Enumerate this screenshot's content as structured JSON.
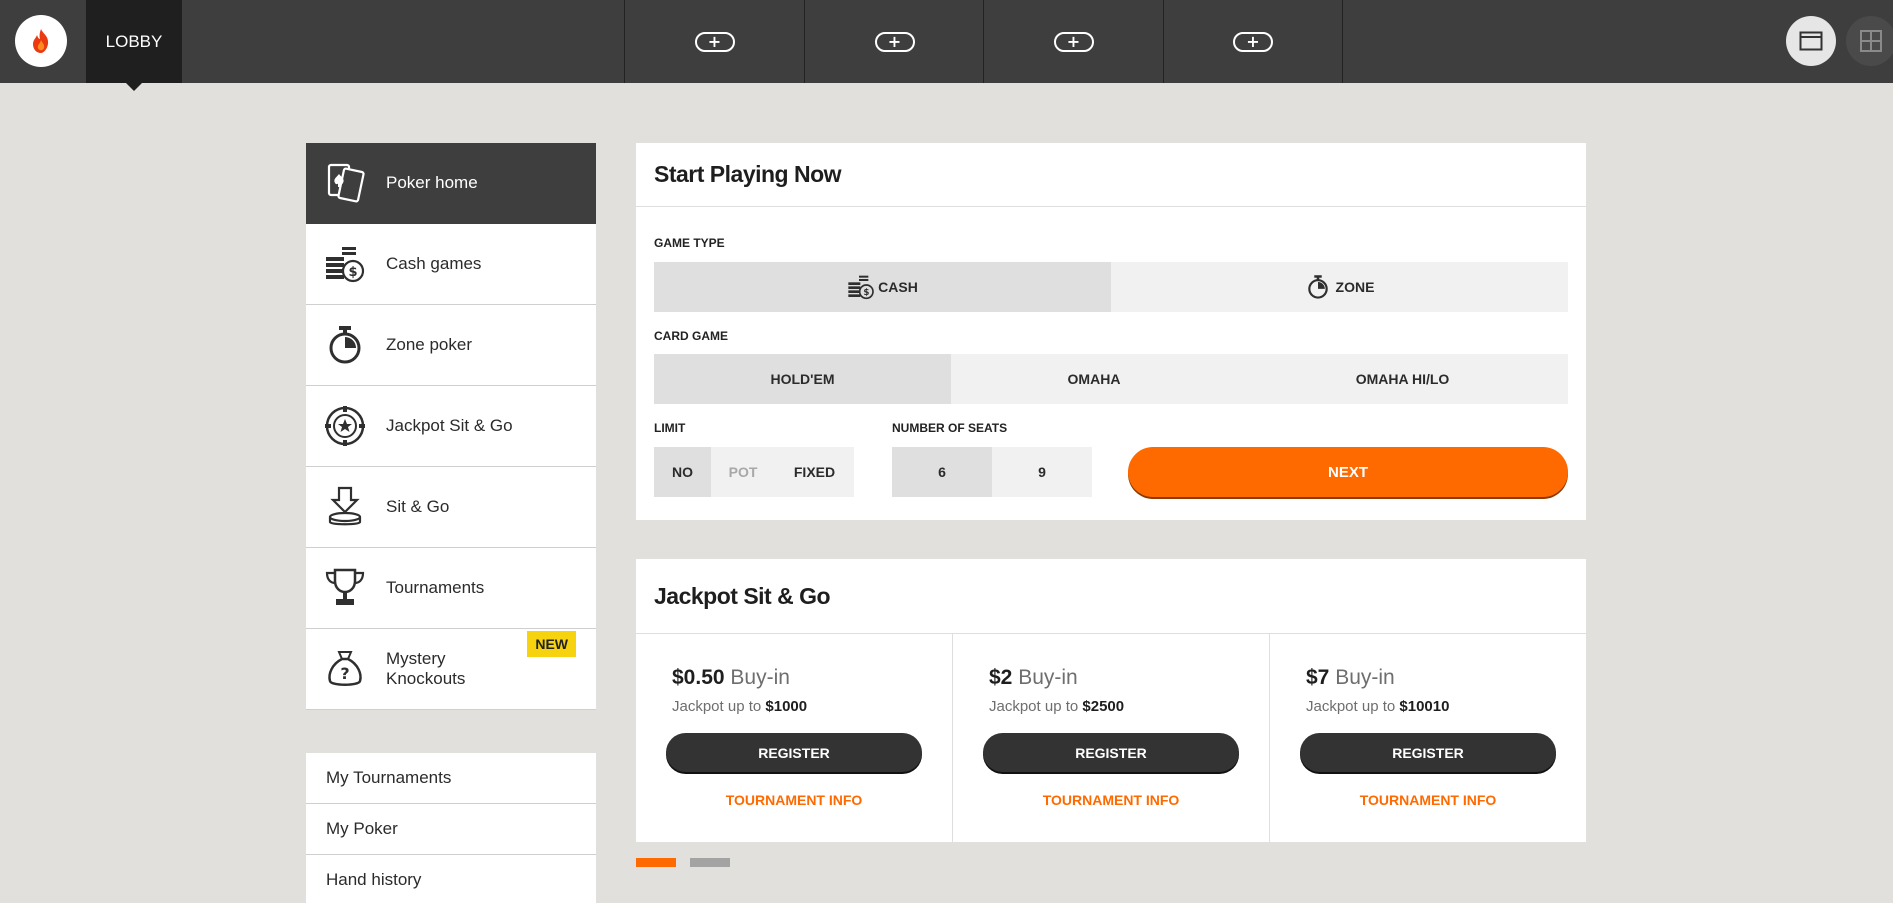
{
  "topbar": {
    "lobby_label": "LOBBY",
    "table_slots": [
      "+",
      "+",
      "+",
      "+"
    ]
  },
  "sidebar": {
    "items": [
      {
        "label": "Poker home",
        "icon": "cards-icon"
      },
      {
        "label": "Cash games",
        "icon": "coins-icon"
      },
      {
        "label": "Zone poker",
        "icon": "stopwatch-icon"
      },
      {
        "label": "Jackpot Sit & Go",
        "icon": "chip-star-icon"
      },
      {
        "label": "Sit & Go",
        "icon": "download-chips-icon"
      },
      {
        "label": "Tournaments",
        "icon": "trophy-icon"
      },
      {
        "label": "Mystery Knockouts",
        "icon": "mystery-bag-icon",
        "badge": "NEW"
      }
    ],
    "secondary": [
      "My Tournaments",
      "My Poker",
      "Hand history"
    ]
  },
  "start": {
    "title": "Start Playing Now",
    "game_type_label": "GAME TYPE",
    "game_types": [
      "CASH",
      "ZONE"
    ],
    "card_game_label": "CARD GAME",
    "card_games": [
      "HOLD'EM",
      "OMAHA",
      "OMAHA HI/LO"
    ],
    "limit_label": "LIMIT",
    "limits": [
      "NO",
      "POT",
      "FIXED"
    ],
    "seats_label": "NUMBER OF SEATS",
    "seats": [
      "6",
      "9"
    ],
    "next_label": "NEXT"
  },
  "jackpot": {
    "title": "Jackpot Sit & Go",
    "cards": [
      {
        "price": "$0.50",
        "buyin": "Buy-in",
        "jackpot_prefix": "Jackpot up to",
        "jackpot": "$1000",
        "register": "REGISTER",
        "info": "TOURNAMENT INFO"
      },
      {
        "price": "$2",
        "buyin": "Buy-in",
        "jackpot_prefix": "Jackpot up to",
        "jackpot": "$2500",
        "register": "REGISTER",
        "info": "TOURNAMENT INFO"
      },
      {
        "price": "$7",
        "buyin": "Buy-in",
        "jackpot_prefix": "Jackpot up to",
        "jackpot": "$10010",
        "register": "REGISTER",
        "info": "TOURNAMENT INFO"
      }
    ]
  },
  "colors": {
    "accent": "#ff6a00",
    "dark": "#3e3e3e",
    "badge": "#f6d20f"
  }
}
